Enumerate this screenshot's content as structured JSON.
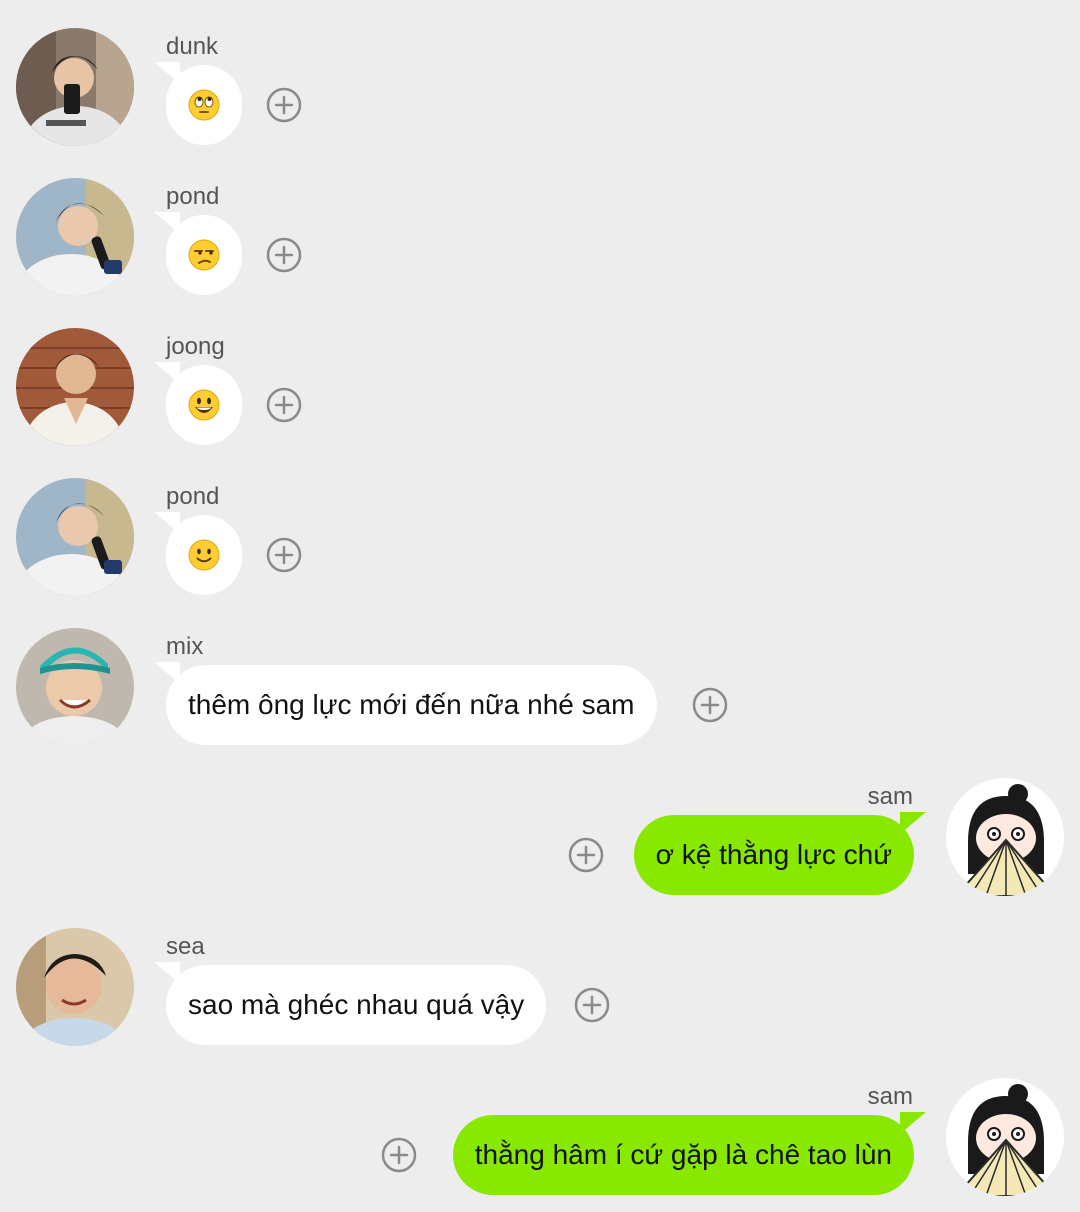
{
  "colors": {
    "background": "#ededed",
    "incoming_bubble": "#ffffff",
    "outgoing_bubble": "#89e800",
    "sender_text": "#555555",
    "react_icon": "#8a8a8a"
  },
  "messages": [
    {
      "sender": "dunk",
      "direction": "incoming",
      "type": "emoji",
      "emoji_icon": "face-with-rolling-eyes-icon",
      "text": ""
    },
    {
      "sender": "pond",
      "direction": "incoming",
      "type": "emoji",
      "emoji_icon": "unamused-face-icon",
      "text": ""
    },
    {
      "sender": "joong",
      "direction": "incoming",
      "type": "emoji",
      "emoji_icon": "grinning-face-icon",
      "text": ""
    },
    {
      "sender": "pond",
      "direction": "incoming",
      "type": "emoji",
      "emoji_icon": "slightly-smiling-face-icon",
      "text": ""
    },
    {
      "sender": "mix",
      "direction": "incoming",
      "type": "text",
      "text": "thêm ông lực mới đến nữa nhé sam"
    },
    {
      "sender": "sam",
      "direction": "outgoing",
      "type": "text",
      "text": "ơ kệ thằng lực chứ"
    },
    {
      "sender": "sea",
      "direction": "incoming",
      "type": "text",
      "text": "sao mà ghéc nhau quá vậy"
    },
    {
      "sender": "sam",
      "direction": "outgoing",
      "type": "text",
      "text": "thằng hâm í cứ gặp là chê tao lùn"
    }
  ],
  "react_button_icon": "add-reaction-icon"
}
